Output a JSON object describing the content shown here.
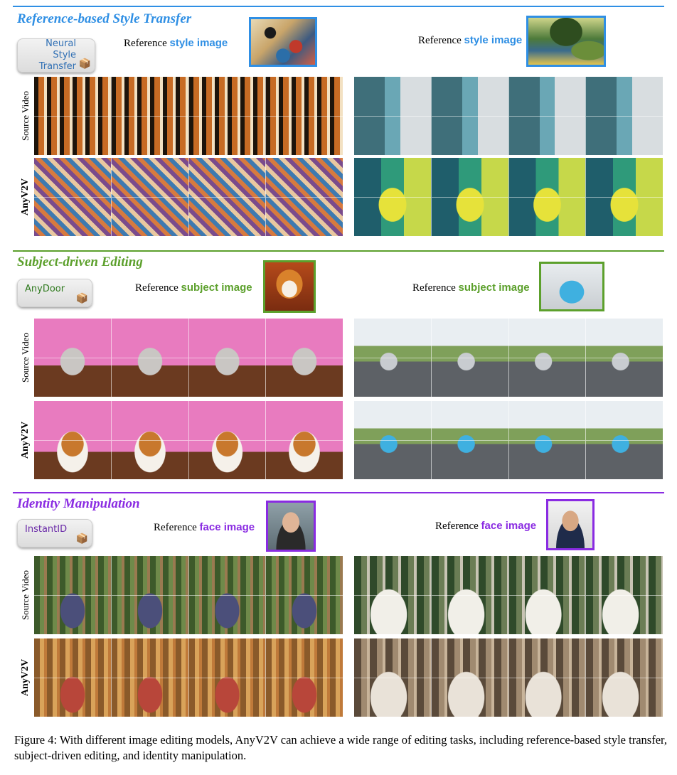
{
  "sections": [
    {
      "title": "Reference-based Style Transfer",
      "color": "#2f8fe4",
      "model": "Neural Style Transfer",
      "model_lines": [
        "Neural Style",
        "Transfer"
      ],
      "ref_prefix": "Reference",
      "ref_kind": "style image",
      "left_rows": [
        "Source Video",
        "AnyV2V"
      ],
      "right_rows": []
    },
    {
      "title": "Subject-driven Editing",
      "color": "#5ca02c",
      "model": "AnyDoor",
      "ref_prefix": "Reference",
      "ref_kind": "subject image",
      "left_rows": [
        "Source Video",
        "AnyV2V"
      ]
    },
    {
      "title": "Identity Manipulation",
      "color": "#8a2be2",
      "model": "InstantID",
      "ref_prefix": "Reference",
      "ref_kind": "face image",
      "left_rows": [
        "Source Video",
        "AnyV2V"
      ]
    }
  ],
  "caption": "Figure 4: With different image editing models, AnyV2V can achieve a wide range of editing tasks, including reference-based style transfer, subject-driven editing, and identity manipulation."
}
